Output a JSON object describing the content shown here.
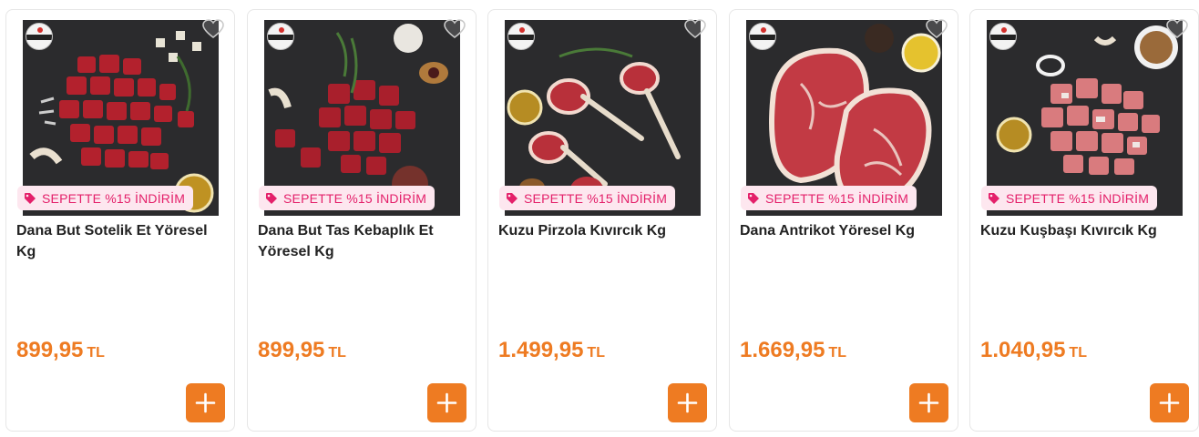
{
  "products": [
    {
      "name": "Dana But Sotelik Et Yöresel Kg",
      "badge": "SEPETTE %15 İNDİRİM",
      "price": "899,95",
      "currency": "TL",
      "image_icon": "diced-beef-image"
    },
    {
      "name": "Dana But Tas Kebaplık Et Yöresel Kg",
      "badge": "SEPETTE %15 İNDİRİM",
      "price": "899,95",
      "currency": "TL",
      "image_icon": "beef-cubes-image"
    },
    {
      "name": "Kuzu Pirzola Kıvırcık Kg",
      "badge": "SEPETTE %15 İNDİRİM",
      "price": "1.499,95",
      "currency": "TL",
      "image_icon": "lamb-chops-image"
    },
    {
      "name": "Dana Antrikot Yöresel Kg",
      "badge": "SEPETTE %15 İNDİRİM",
      "price": "1.669,95",
      "currency": "TL",
      "image_icon": "ribeye-steak-image"
    },
    {
      "name": "Kuzu Kuşbaşı Kıvırcık Kg",
      "badge": "SEPETTE %15 İNDİRİM",
      "price": "1.040,95",
      "currency": "TL",
      "image_icon": "lamb-cubes-image"
    }
  ],
  "colors": {
    "accent": "#ee7b22",
    "badge_text": "#e4206a",
    "badge_bg": "#fde7ef",
    "image_bg": "#2b2b2d"
  }
}
